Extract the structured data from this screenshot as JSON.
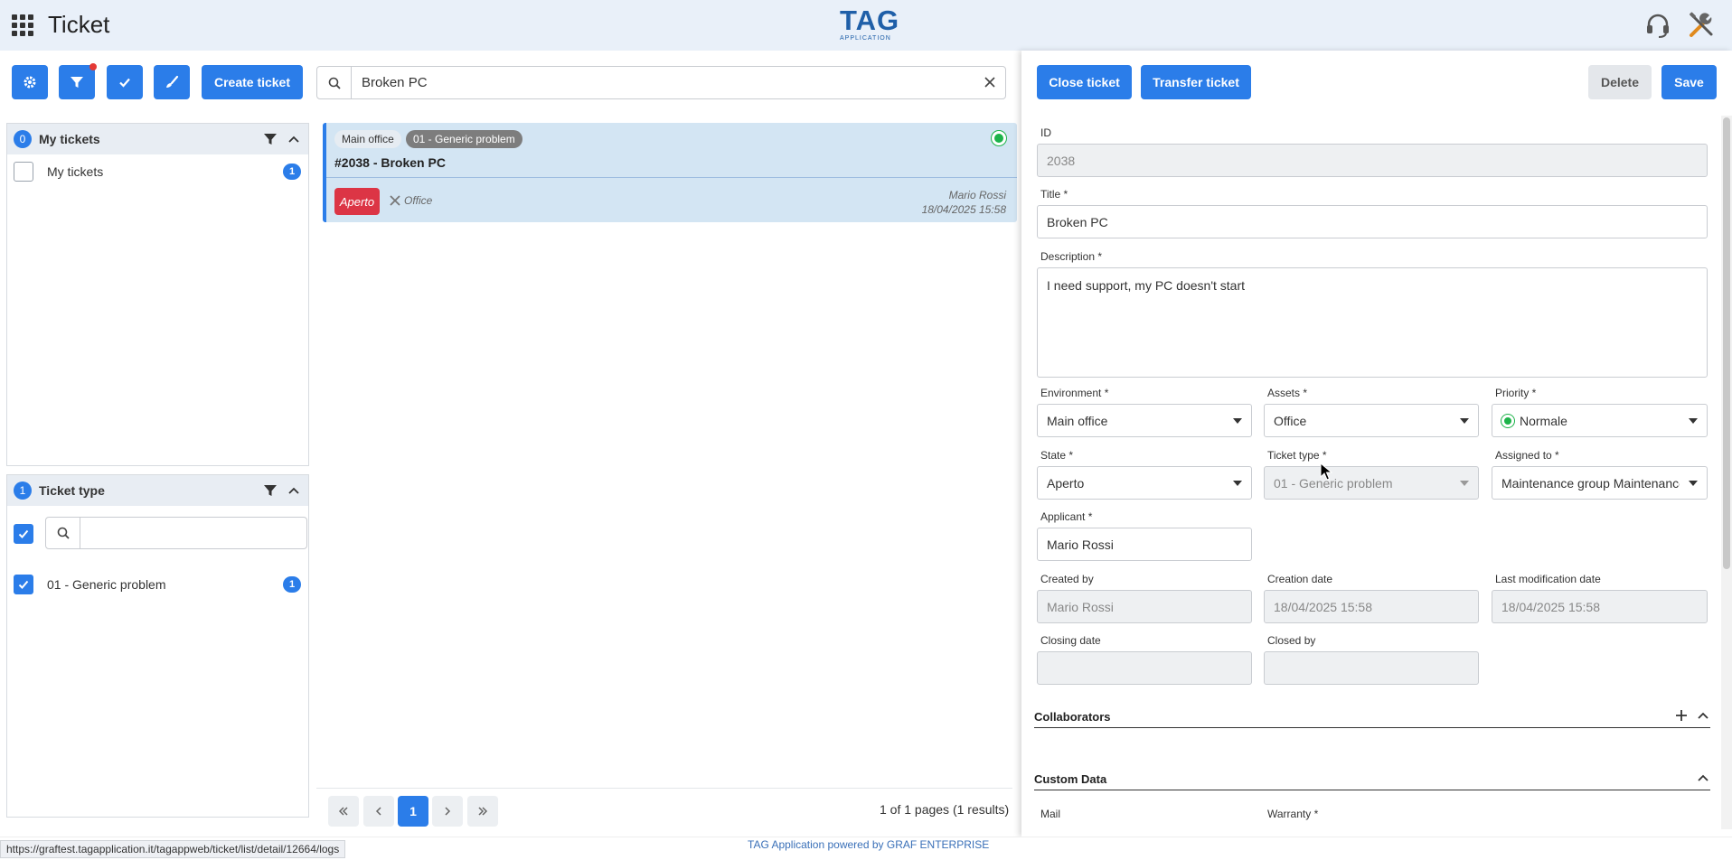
{
  "header": {
    "title": "Ticket",
    "logo_text": "TAG",
    "logo_subtext": "APPLICATION"
  },
  "toolbar": {
    "create_ticket_label": "Create ticket"
  },
  "search": {
    "value": "Broken PC"
  },
  "my_tickets_panel": {
    "count": "0",
    "title": "My tickets",
    "items": [
      {
        "label": "My tickets",
        "count": "1"
      }
    ]
  },
  "ticket_type_panel": {
    "count": "1",
    "title": "Ticket type",
    "search_placeholder": "",
    "items": [
      {
        "label": "01 - Generic problem",
        "count": "1",
        "checked": true
      }
    ]
  },
  "ticket_card": {
    "environment": "Main office",
    "type": "01 - Generic problem",
    "title": "#2038 - Broken PC",
    "state": "Aperto",
    "asset": "Office",
    "user": "Mario Rossi",
    "date": "18/04/2025 15:58"
  },
  "pagination": {
    "current_page": "1",
    "info": "1 of 1 pages (1 results)"
  },
  "detail": {
    "close_ticket_label": "Close ticket",
    "transfer_ticket_label": "Transfer ticket",
    "delete_label": "Delete",
    "save_label": "Save",
    "labels": {
      "id": "ID",
      "title": "Title *",
      "description": "Description *",
      "environment": "Environment *",
      "assets": "Assets *",
      "priority": "Priority *",
      "state": "State *",
      "ticket_type": "Ticket type *",
      "assigned_to": "Assigned to *",
      "applicant": "Applicant *",
      "created_by": "Created by",
      "creation_date": "Creation date",
      "last_modification_date": "Last modification date",
      "closing_date": "Closing date",
      "closed_by": "Closed by",
      "mail": "Mail",
      "warranty": "Warranty *"
    },
    "values": {
      "id": "2038",
      "title": "Broken PC",
      "description": "I need support, my PC doesn't start",
      "environment": "Main office",
      "assets": "Office",
      "priority": "Normale",
      "state": "Aperto",
      "ticket_type": "01 - Generic problem",
      "assigned_to": "Maintenance group Maintenance",
      "applicant": "Mario Rossi",
      "created_by": "Mario Rossi",
      "creation_date": "18/04/2025 15:58",
      "last_modification_date": "18/04/2025 15:58",
      "closing_date": "",
      "closed_by": ""
    },
    "sections": {
      "collaborators": "Collaborators",
      "custom_data": "Custom Data"
    }
  },
  "footer": {
    "url": "https://graftest.tagapplication.it/tagappweb/ticket/list/detail/12664/logs",
    "powered_by": "TAG Application powered by GRAF ENTERPRISE"
  },
  "colors": {
    "accent": "#2b7de9",
    "header_bg": "#e9f0f9",
    "card_bg": "#d3e5f3",
    "state_red": "#dc3545",
    "status_green": "#1db34a"
  }
}
